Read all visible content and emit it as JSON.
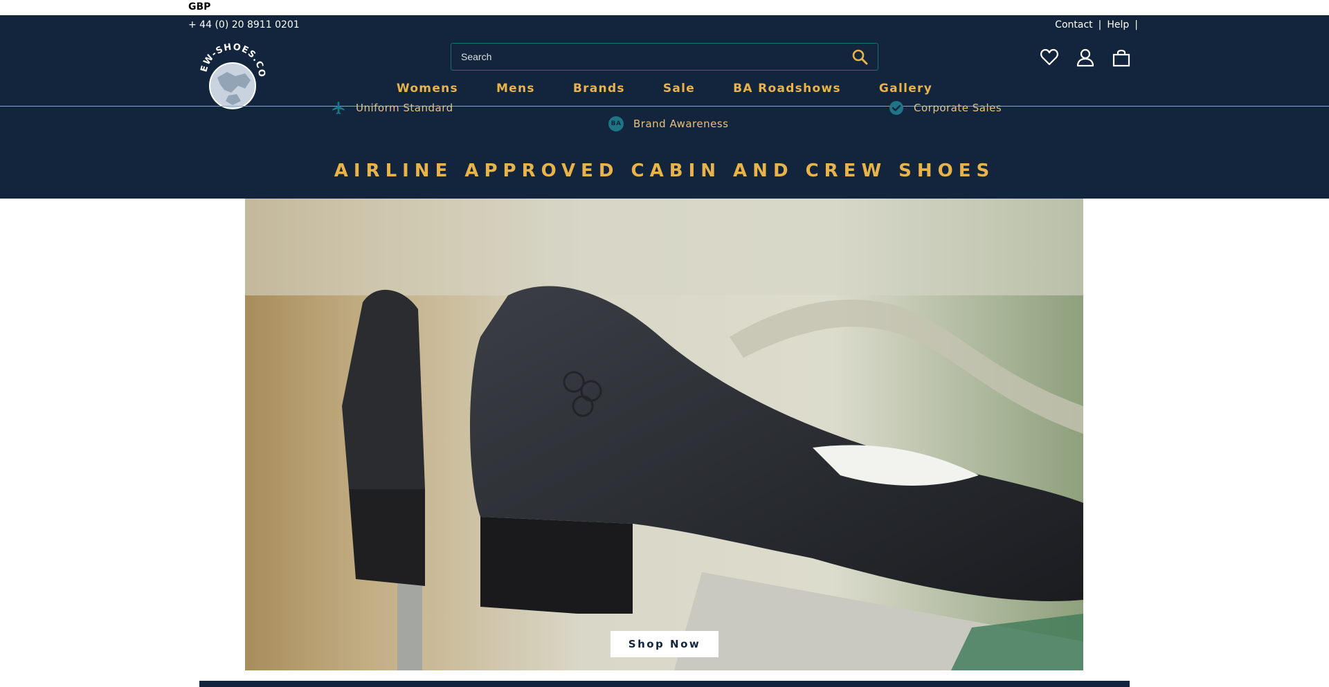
{
  "top_bar": {
    "currency": "GBP"
  },
  "header": {
    "phone": "+ 44 (0) 20 8911 0201",
    "links": [
      {
        "label": "Contact"
      },
      {
        "label": "Help"
      }
    ],
    "separator": "|",
    "logo_text": "CREW-SHOES.COM",
    "search": {
      "placeholder": "Search"
    },
    "icons": [
      "heart-icon",
      "user-icon",
      "bag-icon"
    ]
  },
  "nav": {
    "items": [
      {
        "label": "Womens"
      },
      {
        "label": "Mens"
      },
      {
        "label": "Brands"
      },
      {
        "label": "Sale"
      },
      {
        "label": "BA Roadshows"
      },
      {
        "label": "Gallery"
      }
    ]
  },
  "usps": [
    {
      "label": "Uniform Standard",
      "icon": "plane-icon"
    },
    {
      "label": "Brand Awareness",
      "icon": "ba-badge-icon",
      "badge": "BA"
    },
    {
      "label": "Corporate Sales",
      "icon": "check-circle-icon"
    }
  ],
  "headline": "AIRLINE APPROVED CABIN AND CREW SHOES",
  "hero": {
    "button_label": "Shop Now"
  },
  "colors": {
    "navy": "#12253c",
    "gold": "#e9b34b",
    "teal": "#1f7585"
  }
}
